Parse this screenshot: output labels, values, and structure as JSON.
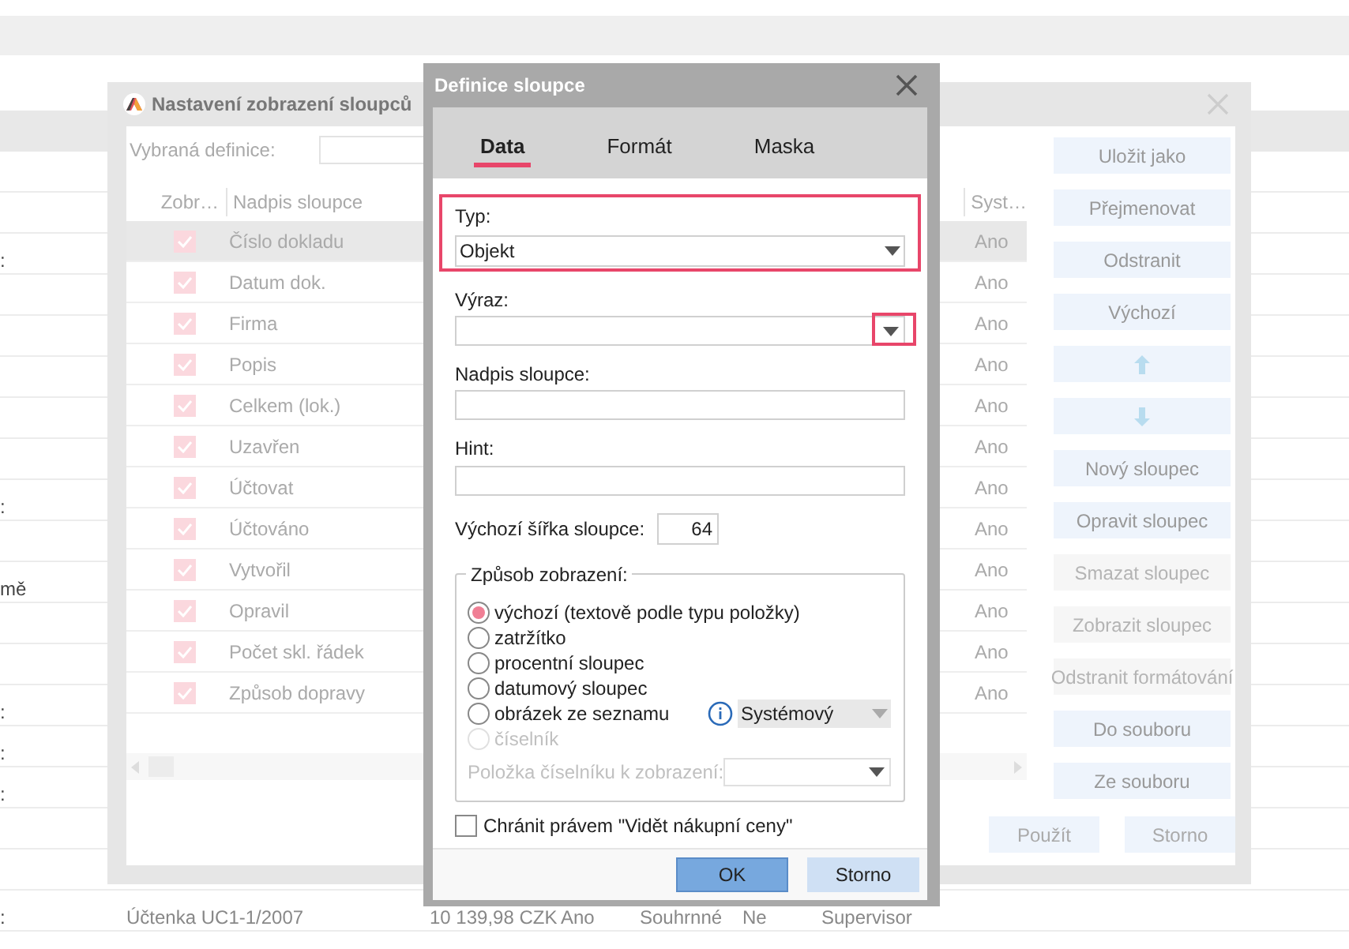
{
  "background": {
    "rows": [
      {},
      {},
      {
        "column_1": ":"
      },
      {},
      {},
      {},
      {},
      {},
      {
        "column_1": ":"
      },
      {},
      {
        "column_1": "mě"
      },
      {},
      {},
      {
        "column_1": ":"
      },
      {
        "column_1": ":"
      },
      {
        "column_1": ":"
      },
      {},
      {},
      {
        "column_1": ":",
        "column_2": "Účtenka UC1-1/2007",
        "column_3": "10 139,98 CZK",
        "column_4": "Ano",
        "column_5": "Souhrnné",
        "column_6": "Ne",
        "column_7": "Supervisor"
      }
    ]
  },
  "settings_window": {
    "title": "Nastavení zobrazení sloupců",
    "definition_label": "Vybraná definice:",
    "columns": [
      "Zobr…",
      "Nadpis sloupce",
      "Syst…"
    ],
    "rows": [
      {
        "checked": true,
        "caption": "Číslo dokladu",
        "system": "Ano",
        "selected": true
      },
      {
        "checked": true,
        "caption": "Datum dok.",
        "system": "Ano",
        "selected": false
      },
      {
        "checked": true,
        "caption": "Firma",
        "system": "Ano",
        "selected": false
      },
      {
        "checked": true,
        "caption": "Popis",
        "system": "Ano",
        "selected": false
      },
      {
        "checked": true,
        "caption": "Celkem (lok.)",
        "system": "Ano",
        "selected": false
      },
      {
        "checked": true,
        "caption": "Uzavřen",
        "system": "Ano",
        "selected": false
      },
      {
        "checked": true,
        "caption": "Účtovat",
        "system": "Ano",
        "selected": false
      },
      {
        "checked": true,
        "caption": "Účtováno",
        "system": "Ano",
        "selected": false
      },
      {
        "checked": true,
        "caption": "Vytvořil",
        "system": "Ano",
        "selected": false
      },
      {
        "checked": true,
        "caption": "Opravil",
        "system": "Ano",
        "selected": false
      },
      {
        "checked": true,
        "caption": "Počet skl. řádek",
        "system": "Ano",
        "selected": false
      },
      {
        "checked": true,
        "caption": "Způsob dopravy",
        "system": "Ano",
        "selected": false
      }
    ],
    "buttons": [
      {
        "kind": "text",
        "label": "Uložit jako",
        "disabled": false
      },
      {
        "kind": "text",
        "label": "Přejmenovat",
        "disabled": false
      },
      {
        "kind": "text",
        "label": "Odstranit",
        "disabled": false
      },
      {
        "kind": "text",
        "label": "Výchozí",
        "disabled": false
      },
      {
        "kind": "up",
        "disabled": false
      },
      {
        "kind": "down",
        "disabled": false
      },
      {
        "kind": "text",
        "label": "Nový sloupec",
        "disabled": false
      },
      {
        "kind": "text",
        "label": "Opravit sloupec",
        "disabled": false
      },
      {
        "kind": "text",
        "label": "Smazat sloupec",
        "disabled": true
      },
      {
        "kind": "text",
        "label": "Zobrazit sloupec",
        "disabled": true
      },
      {
        "kind": "text",
        "label": "Odstranit formátování",
        "disabled": true
      },
      {
        "kind": "text",
        "label": "Do souboru",
        "disabled": false
      },
      {
        "kind": "text",
        "label": "Ze souboru",
        "disabled": false
      }
    ],
    "footer_buttons": [
      "Použít",
      "Storno"
    ]
  },
  "column_dialog": {
    "title": "Definice sloupce",
    "tabs": [
      {
        "label": "Data",
        "selected": true
      },
      {
        "label": "Formát",
        "selected": false
      },
      {
        "label": "Maska",
        "selected": false
      }
    ],
    "type_field": {
      "label": "Typ:",
      "value": "Objekt",
      "highlighted": true
    },
    "expression_field": {
      "label": "Výraz:",
      "arrow_highlighted": true
    },
    "caption_field": {
      "label": "Nadpis sloupce:"
    },
    "hint_field": {
      "label": "Hint:"
    },
    "width_field": {
      "label": "Výchozí šířka sloupce:",
      "value": "64"
    },
    "display_group": {
      "title": "Způsob zobrazení:",
      "options": [
        {
          "label": "výchozí (textově podle typu položky)",
          "selected": true,
          "disabled": false
        },
        {
          "label": "zatržítko",
          "selected": false,
          "disabled": false
        },
        {
          "label": "procentní sloupec",
          "selected": false,
          "disabled": false
        },
        {
          "label": "datumový sloupec",
          "selected": false,
          "disabled": false
        },
        {
          "label": "obrázek ze seznamu",
          "selected": false,
          "disabled": false
        },
        {
          "label": "číselník",
          "selected": false,
          "disabled": true
        }
      ],
      "image_list": {
        "value": "Systémový",
        "disabled": true
      },
      "codebook_item": {
        "label": "Položka číselníku k zobrazení:",
        "disabled": true
      }
    },
    "protect_checkbox": {
      "label": "Chránit právem \"Vidět nákupní ceny\"",
      "checked": false
    },
    "buttons": [
      {
        "label": "OK",
        "kind": "primary"
      },
      {
        "label": "Storno",
        "kind": "secondary"
      }
    ]
  }
}
